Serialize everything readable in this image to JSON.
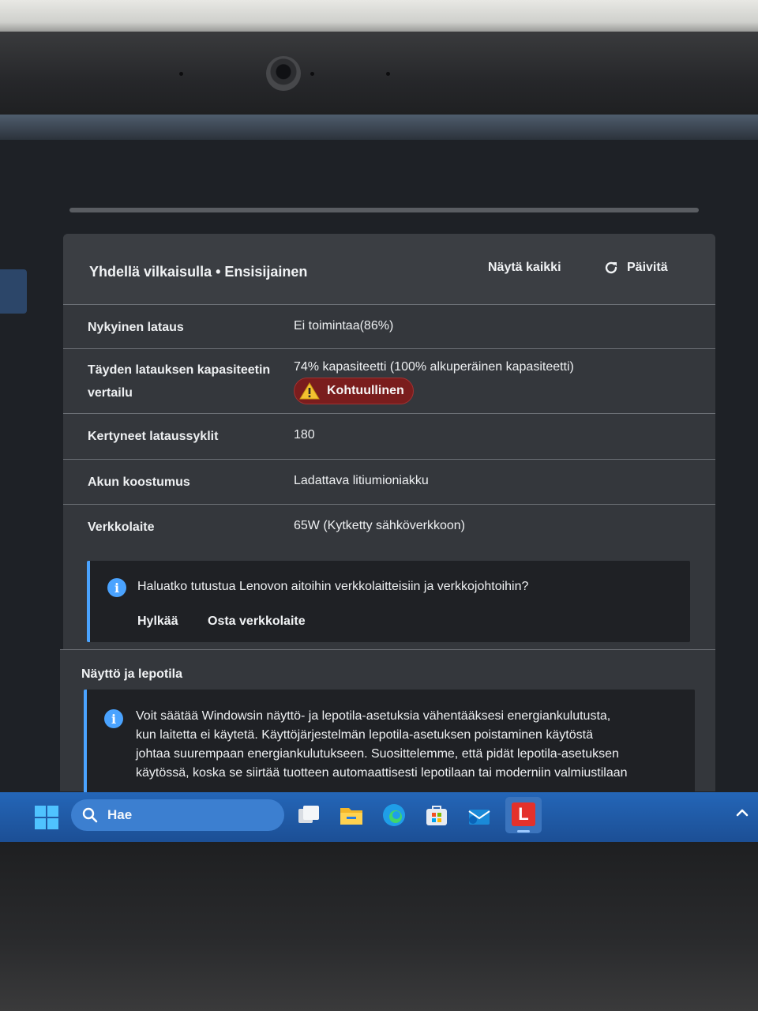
{
  "panel": {
    "title": "Yhdellä vilkaisulla • Ensisijainen",
    "show_all": "Näytä kaikki",
    "refresh": "Päivitä"
  },
  "rows": [
    {
      "label": "Nykyinen lataus",
      "value": "Ei toimintaa(86%)"
    },
    {
      "label": "Täyden latauksen kapasiteetin",
      "label2": "vertailu",
      "value": "74% kapasiteetti (100% alkuperäinen kapasiteetti)",
      "badge": "Kohtuullinen"
    },
    {
      "label": "Kertyneet lataussyklit",
      "value": "180"
    },
    {
      "label": "Akun koostumus",
      "value": "Ladattava litiumioniakku"
    },
    {
      "label": "Verkkolaite",
      "value": "65W (Kytketty sähköverkkoon)"
    }
  ],
  "promo": {
    "text": "Haluatko tutustua Lenovon aitoihin verkkolaitteisiin ja verkkojohtoihin?",
    "dismiss": "Hylkää",
    "buy": "Osta verkkolaite"
  },
  "sleep_section": {
    "title": "Näyttö ja lepotila",
    "lines": [
      "Voit säätää Windowsin näyttö- ja lepotila-asetuksia vähentääksesi energiankulutusta,",
      "kun laitetta ei käytetä. Käyttöjärjestelmän lepotila-asetuksen poistaminen käytöstä",
      "johtaa suurempaan energiankulutukseen. Suosittelemme, että pidät lepotila-asetuksen",
      "käytössä, koska se siirtää tuotteen automaattisesti lepotilaan tai moderniin valmiustilaan"
    ]
  },
  "taskbar": {
    "search_label": "Hae",
    "apps": [
      "task-view-icon",
      "file-explorer-icon",
      "edge-icon",
      "store-icon",
      "mail-icon",
      "lenovo-vantage-icon"
    ],
    "lenovo_letter": "L"
  },
  "colors": {
    "accent": "#4aa3ff",
    "warning_badge": "#7a1d1d",
    "taskbar": "#2466b8"
  }
}
